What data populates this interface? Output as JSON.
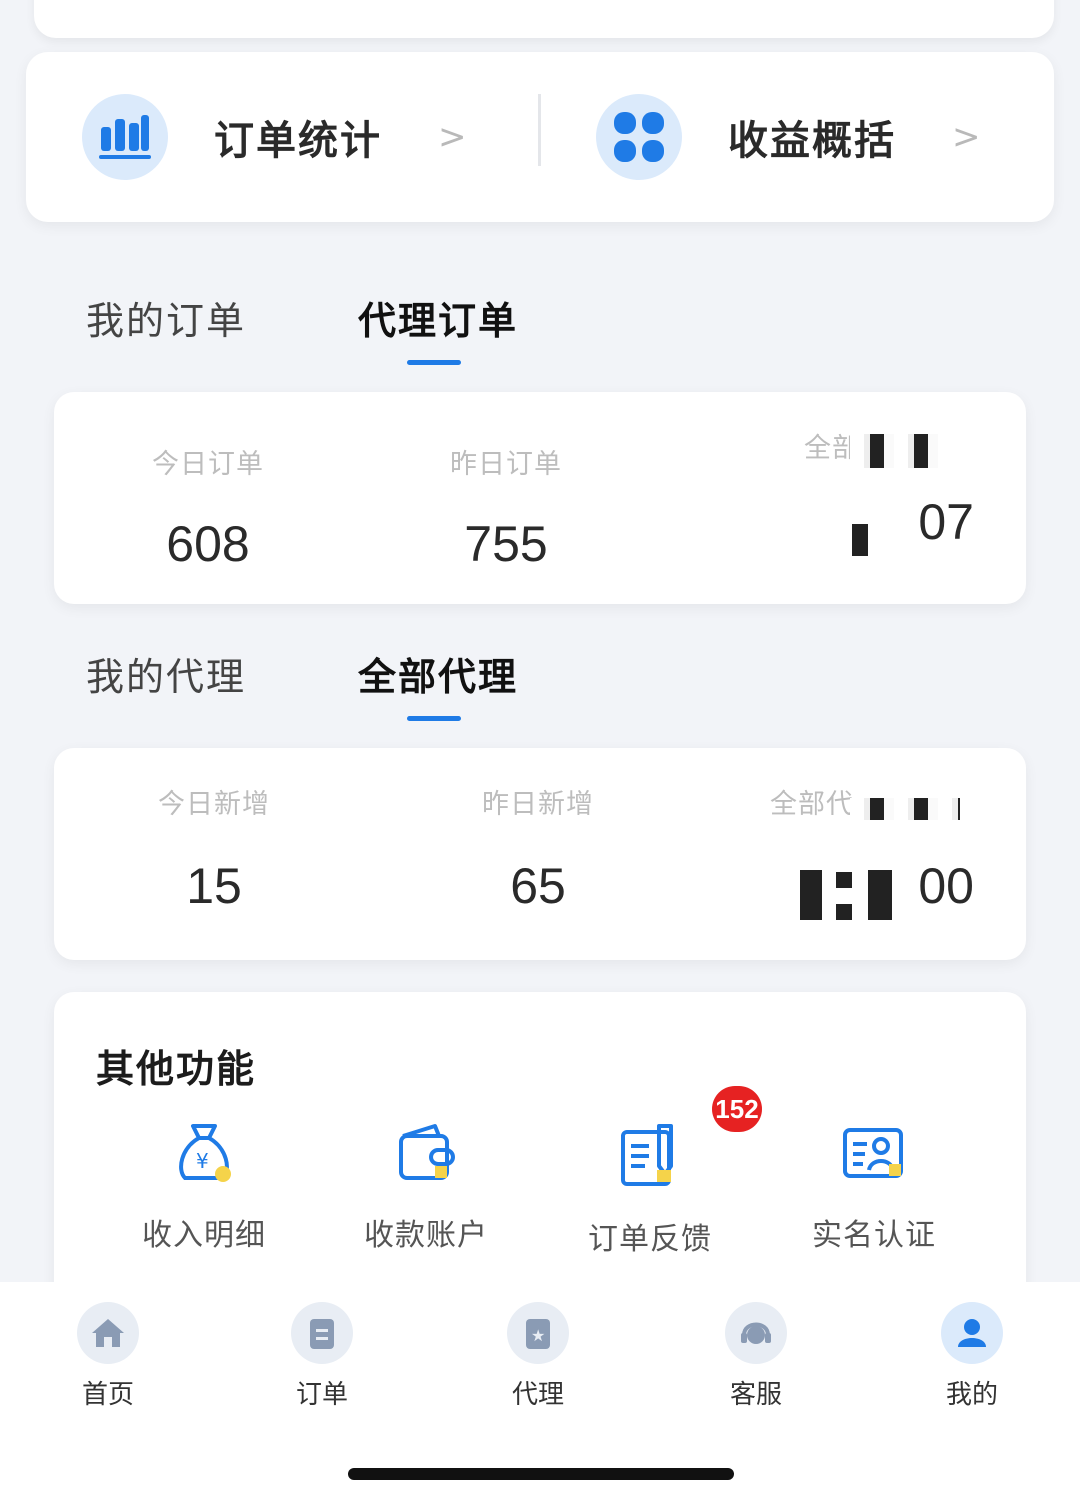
{
  "entries": [
    {
      "label": "订单统计",
      "chevron": ">",
      "icon": "bar-chart-icon"
    },
    {
      "label": "收益概括",
      "chevron": ">",
      "icon": "grid-icon"
    }
  ],
  "order_tabs": {
    "inactive": "我的订单",
    "active": "代理订单"
  },
  "order_stats": [
    {
      "label": "今日订单",
      "value": "608"
    },
    {
      "label": "昨日订单",
      "value": "755"
    },
    {
      "label": "全部",
      "value": "07"
    }
  ],
  "agent_tabs": {
    "inactive": "我的代理",
    "active": "全部代理"
  },
  "agent_stats": [
    {
      "label": "今日新增",
      "value": "15"
    },
    {
      "label": "昨日新增",
      "value": "65"
    },
    {
      "label": "全部代",
      "value": "00"
    }
  ],
  "other": {
    "title": "其他功能",
    "items": [
      {
        "label": "收入明细",
        "icon": "money-bag-icon"
      },
      {
        "label": "收款账户",
        "icon": "wallet-icon"
      },
      {
        "label": "订单反馈",
        "icon": "feedback-icon",
        "badge": "152"
      },
      {
        "label": "实名认证",
        "icon": "id-card-icon"
      }
    ]
  },
  "nav": [
    {
      "label": "首页",
      "icon": "home-icon"
    },
    {
      "label": "订单",
      "icon": "order-icon"
    },
    {
      "label": "代理",
      "icon": "agent-icon"
    },
    {
      "label": "客服",
      "icon": "customer-service-icon"
    },
    {
      "label": "我的",
      "icon": "profile-icon"
    }
  ],
  "colors": {
    "accent": "#1f7be6",
    "badge": "#e62222",
    "icon_bg": "#dbeafb"
  }
}
